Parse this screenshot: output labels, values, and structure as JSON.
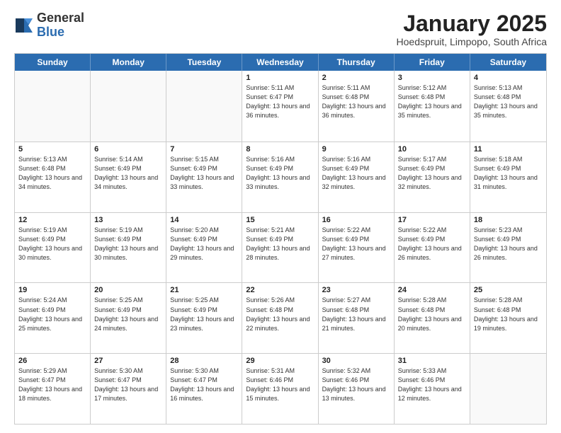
{
  "logo": {
    "general": "General",
    "blue": "Blue"
  },
  "title": "January 2025",
  "subtitle": "Hoedspruit, Limpopo, South Africa",
  "headers": [
    "Sunday",
    "Monday",
    "Tuesday",
    "Wednesday",
    "Thursday",
    "Friday",
    "Saturday"
  ],
  "weeks": [
    [
      {
        "day": "",
        "info": ""
      },
      {
        "day": "",
        "info": ""
      },
      {
        "day": "",
        "info": ""
      },
      {
        "day": "1",
        "info": "Sunrise: 5:11 AM\nSunset: 6:47 PM\nDaylight: 13 hours and 36 minutes."
      },
      {
        "day": "2",
        "info": "Sunrise: 5:11 AM\nSunset: 6:48 PM\nDaylight: 13 hours and 36 minutes."
      },
      {
        "day": "3",
        "info": "Sunrise: 5:12 AM\nSunset: 6:48 PM\nDaylight: 13 hours and 35 minutes."
      },
      {
        "day": "4",
        "info": "Sunrise: 5:13 AM\nSunset: 6:48 PM\nDaylight: 13 hours and 35 minutes."
      }
    ],
    [
      {
        "day": "5",
        "info": "Sunrise: 5:13 AM\nSunset: 6:48 PM\nDaylight: 13 hours and 34 minutes."
      },
      {
        "day": "6",
        "info": "Sunrise: 5:14 AM\nSunset: 6:49 PM\nDaylight: 13 hours and 34 minutes."
      },
      {
        "day": "7",
        "info": "Sunrise: 5:15 AM\nSunset: 6:49 PM\nDaylight: 13 hours and 33 minutes."
      },
      {
        "day": "8",
        "info": "Sunrise: 5:16 AM\nSunset: 6:49 PM\nDaylight: 13 hours and 33 minutes."
      },
      {
        "day": "9",
        "info": "Sunrise: 5:16 AM\nSunset: 6:49 PM\nDaylight: 13 hours and 32 minutes."
      },
      {
        "day": "10",
        "info": "Sunrise: 5:17 AM\nSunset: 6:49 PM\nDaylight: 13 hours and 32 minutes."
      },
      {
        "day": "11",
        "info": "Sunrise: 5:18 AM\nSunset: 6:49 PM\nDaylight: 13 hours and 31 minutes."
      }
    ],
    [
      {
        "day": "12",
        "info": "Sunrise: 5:19 AM\nSunset: 6:49 PM\nDaylight: 13 hours and 30 minutes."
      },
      {
        "day": "13",
        "info": "Sunrise: 5:19 AM\nSunset: 6:49 PM\nDaylight: 13 hours and 30 minutes."
      },
      {
        "day": "14",
        "info": "Sunrise: 5:20 AM\nSunset: 6:49 PM\nDaylight: 13 hours and 29 minutes."
      },
      {
        "day": "15",
        "info": "Sunrise: 5:21 AM\nSunset: 6:49 PM\nDaylight: 13 hours and 28 minutes."
      },
      {
        "day": "16",
        "info": "Sunrise: 5:22 AM\nSunset: 6:49 PM\nDaylight: 13 hours and 27 minutes."
      },
      {
        "day": "17",
        "info": "Sunrise: 5:22 AM\nSunset: 6:49 PM\nDaylight: 13 hours and 26 minutes."
      },
      {
        "day": "18",
        "info": "Sunrise: 5:23 AM\nSunset: 6:49 PM\nDaylight: 13 hours and 26 minutes."
      }
    ],
    [
      {
        "day": "19",
        "info": "Sunrise: 5:24 AM\nSunset: 6:49 PM\nDaylight: 13 hours and 25 minutes."
      },
      {
        "day": "20",
        "info": "Sunrise: 5:25 AM\nSunset: 6:49 PM\nDaylight: 13 hours and 24 minutes."
      },
      {
        "day": "21",
        "info": "Sunrise: 5:25 AM\nSunset: 6:49 PM\nDaylight: 13 hours and 23 minutes."
      },
      {
        "day": "22",
        "info": "Sunrise: 5:26 AM\nSunset: 6:48 PM\nDaylight: 13 hours and 22 minutes."
      },
      {
        "day": "23",
        "info": "Sunrise: 5:27 AM\nSunset: 6:48 PM\nDaylight: 13 hours and 21 minutes."
      },
      {
        "day": "24",
        "info": "Sunrise: 5:28 AM\nSunset: 6:48 PM\nDaylight: 13 hours and 20 minutes."
      },
      {
        "day": "25",
        "info": "Sunrise: 5:28 AM\nSunset: 6:48 PM\nDaylight: 13 hours and 19 minutes."
      }
    ],
    [
      {
        "day": "26",
        "info": "Sunrise: 5:29 AM\nSunset: 6:47 PM\nDaylight: 13 hours and 18 minutes."
      },
      {
        "day": "27",
        "info": "Sunrise: 5:30 AM\nSunset: 6:47 PM\nDaylight: 13 hours and 17 minutes."
      },
      {
        "day": "28",
        "info": "Sunrise: 5:30 AM\nSunset: 6:47 PM\nDaylight: 13 hours and 16 minutes."
      },
      {
        "day": "29",
        "info": "Sunrise: 5:31 AM\nSunset: 6:46 PM\nDaylight: 13 hours and 15 minutes."
      },
      {
        "day": "30",
        "info": "Sunrise: 5:32 AM\nSunset: 6:46 PM\nDaylight: 13 hours and 13 minutes."
      },
      {
        "day": "31",
        "info": "Sunrise: 5:33 AM\nSunset: 6:46 PM\nDaylight: 13 hours and 12 minutes."
      },
      {
        "day": "",
        "info": ""
      }
    ]
  ]
}
